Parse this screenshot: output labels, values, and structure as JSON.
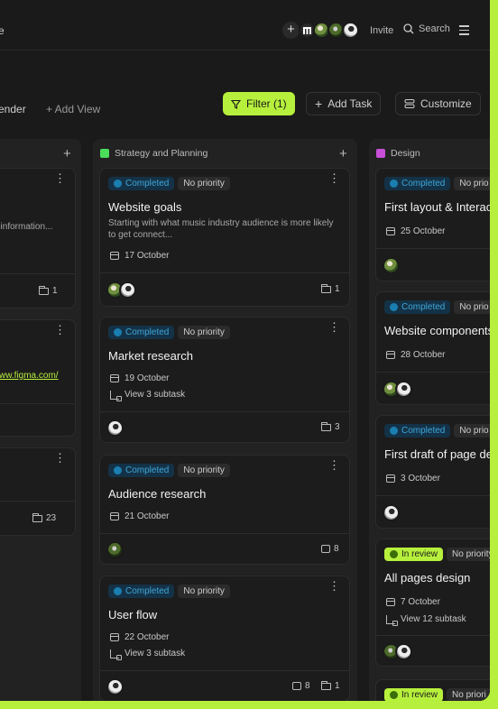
{
  "header": {
    "title_fragment": "e",
    "invite_label": "Invite",
    "search_label": "Search"
  },
  "toolbar": {
    "tab_calendar_fragment": "ender",
    "add_view_label": "+ Add View",
    "filter_label": "Filter (1)",
    "add_task_label": "Add Task",
    "customize_label": "Customize"
  },
  "colors": {
    "accent": "#b7f03c",
    "strategy": "#4ade5a",
    "design": "#c84fd8",
    "completed": "#3ea6d8"
  },
  "left_column": {
    "cards": [
      {
        "desc_fragment": "t information...",
        "files": "1"
      },
      {
        "link_fragment": "ww.figma.com/"
      },
      {
        "files": "23"
      }
    ]
  },
  "strategy_column": {
    "name": "Strategy and Planning",
    "cards": [
      {
        "status": "Completed",
        "priority": "No priority",
        "title": "Website goals",
        "desc": "Starting with what music industry audience is more likely to get connect...",
        "date": "17 October",
        "files": "1"
      },
      {
        "status": "Completed",
        "priority": "No priority",
        "title": "Market research",
        "date": "19 October",
        "subtask": "View 3 subtask",
        "files": "3"
      },
      {
        "status": "Completed",
        "priority": "No priority",
        "title": "Audience research",
        "date": "21 October",
        "comments": "8"
      },
      {
        "status": "Completed",
        "priority": "No priority",
        "title": "User flow",
        "date": "22 October",
        "subtask": "View 3 subtask",
        "comments": "8",
        "files": "1"
      }
    ]
  },
  "design_column": {
    "name": "Design",
    "cards": [
      {
        "status": "Completed",
        "priority": "No prio",
        "title": "First layout & Interac",
        "date": "25 October"
      },
      {
        "status": "Completed",
        "priority": "No prio",
        "title": "Website components",
        "date": "28 October"
      },
      {
        "status": "Completed",
        "priority": "No prio",
        "title": "First draft of page de",
        "date": "3 October"
      },
      {
        "status": "In review",
        "priority": "No priority",
        "title": "All pages design",
        "date": "7 October",
        "subtask": "View 12 subtask"
      },
      {
        "status": "In review",
        "priority": "No priori"
      }
    ]
  }
}
